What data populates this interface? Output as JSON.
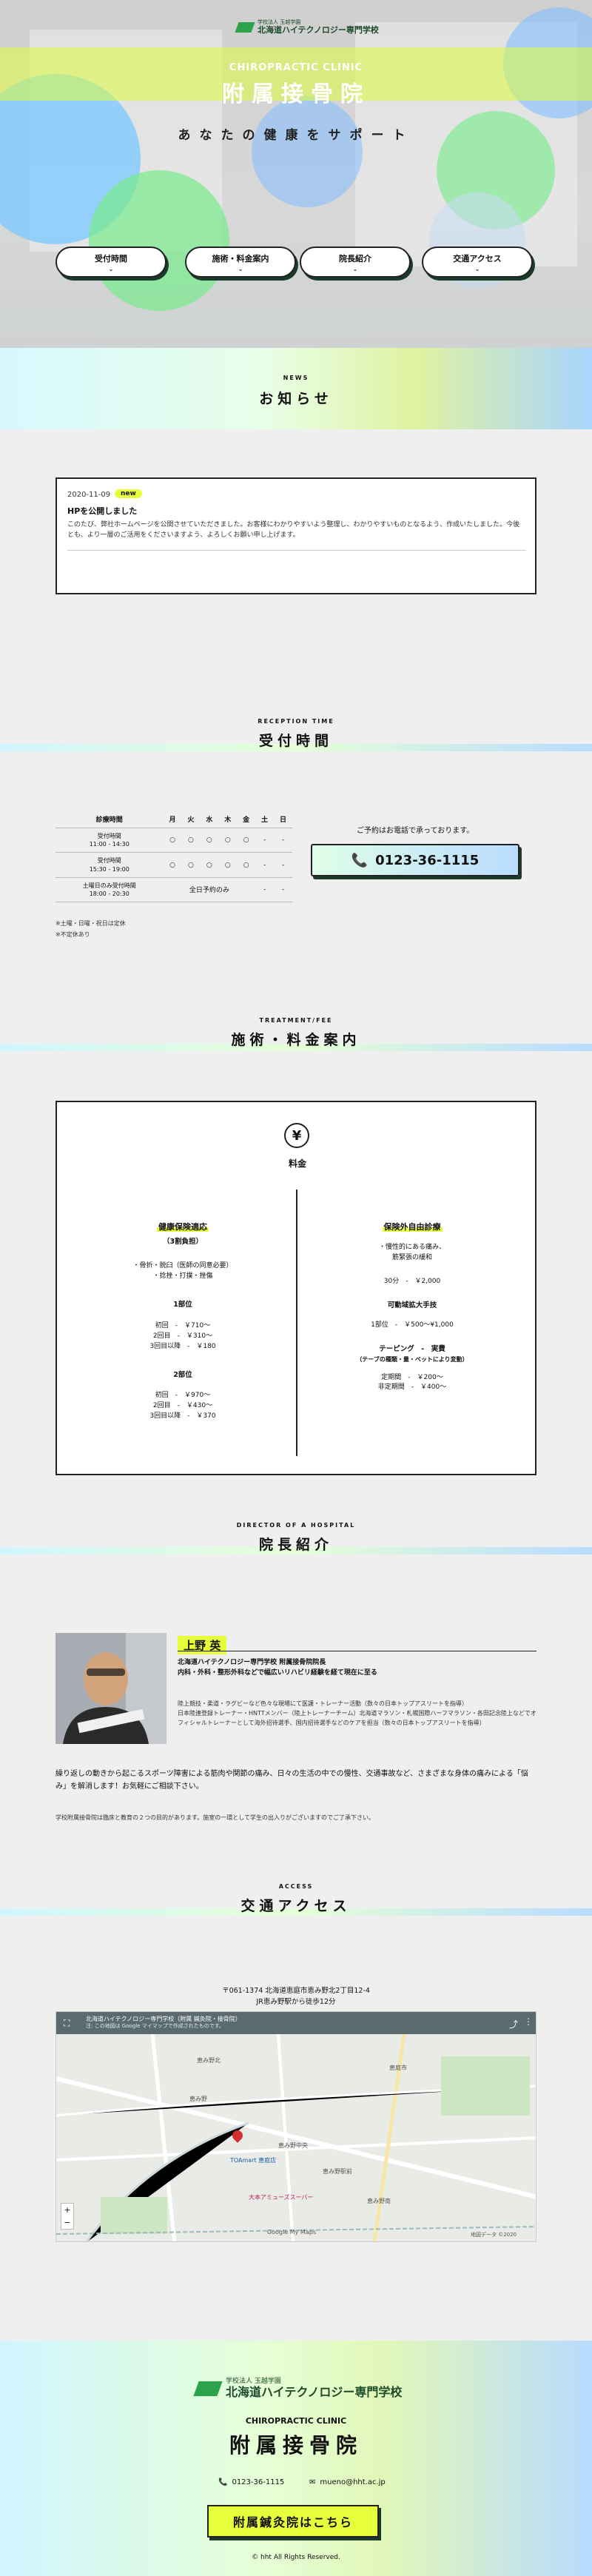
{
  "hero": {
    "logo_small": "学校法人 玉越学園",
    "logo_name": "北海道ハイテクノロジー専門学校",
    "subtitle": "CHIROPRACTIC CLINIC",
    "title": "附属接骨院",
    "lead": "あなたの健康をサポート",
    "buttons": [
      "受付時間",
      "施術・料金案内",
      "院長紹介",
      "交通アクセス"
    ],
    "chevron": "⌄"
  },
  "news": {
    "en": "NEWS",
    "ja": "お知らせ",
    "date": "2020-11-09",
    "badge": "new",
    "title": "HPを公開しました",
    "body": "このたび、弊社ホームページを公開させていただきました。お客様にわかりやすいよう整理し、わかりやすいものとなるよう、作成いたしました。今後とも、より一層のご活用をくださいますよう、よろしくお願い申し上げます。"
  },
  "reception": {
    "en": "RECEPTION TIME",
    "ja": "受付時間",
    "headers": [
      "診療時間",
      "月",
      "火",
      "水",
      "木",
      "金",
      "土",
      "日"
    ],
    "rows": [
      {
        "label": "受付時間",
        "time": "11:00 - 14:30",
        "cells": [
          "○",
          "○",
          "○",
          "○",
          "○",
          "-",
          "-"
        ]
      },
      {
        "label": "受付時間",
        "time": "15:30 - 19:00",
        "cells": [
          "○",
          "○",
          "○",
          "○",
          "○",
          "-",
          "-"
        ]
      },
      {
        "label": "土曜日のみ受付時間",
        "time": "18:00 - 20:30",
        "merged": "全日予約のみ",
        "cells": [
          "-",
          "-"
        ]
      }
    ],
    "tel_note": "ご予約はお電話で承っております。",
    "tel": "0123-36-1115",
    "note1": "※土曜・日曜・祝日は定休",
    "note2": "※不定休あり"
  },
  "treatment": {
    "en": "TREATMENT/FEE",
    "ja": "施術・料金案内",
    "icon": "¥",
    "label": "料金",
    "left": {
      "heading": "健康保険適応",
      "sub": "（3割負担）",
      "desc": "・骨折・脱臼（医師の同意必要）\n・捻挫・打撲・挫傷",
      "part1_title": "1部位",
      "part1_fees": "初回　-　￥710〜\n2回目　-　￥310〜\n3回目以降　-　￥180",
      "part2_title": "2部位",
      "part2_fees": "初回　-　￥970〜\n2回目　-　￥430〜\n3回目以降　-　￥370"
    },
    "right": {
      "heading": "保険外自由診療",
      "desc": "・慢性的にある痛み、\n筋緊張の緩和",
      "fee1": "30分　-　￥2,000",
      "sub_title": "可動域拡大手技",
      "fee2": "1部位　-　￥500〜¥1,000",
      "taping_title": "テーピング　-　実費",
      "taping_sub": "（テーブの種類・量・ベットにより変動）",
      "taping_fees": "定期間　-　￥200〜\n非定期間　-　￥400〜"
    }
  },
  "director": {
    "en": "DIRECTOR OF A HOSPITAL",
    "ja": "院長紹介",
    "name": "上野 英",
    "title": "北海道ハイテクノロジー専門学校 附属接骨院院長\n内科・外科・整形外科などで幅広いリハビリ経験を経て現在に至る",
    "career": "陸上競技・柔道・ラグビーなど色々な現場にて医護・トレーナー活動（数々の日本トップアスリートを指導）\n日本陸連登録トレーナー・HNTTメンバー（陸上トレーナーチーム）北海道マラソン・札幌国際ハーフマラソン・各田記念陸上などでオフィシャルトレーナーとして海外招待選手、国内招待選手などのケアを担当（数々の日本トップアスリートを指導）",
    "message": "繰り返しの動きから起こるスポーツ障害による筋肉や関節の痛み、日々の生活の中での慢性、交通事故など、さまざまな身体の痛みによる「悩み」を解消します！お気軽にご相談下さい。",
    "note": "学校附属接骨院は臨床と教育の２つの目的があります。施室の一環として学生の出入りがございますのでご了承下さい。"
  },
  "access": {
    "en": "ACCESS",
    "ja": "交通アクセス",
    "address": "〒061-1374 北海道恵庭市恵み野北2丁目12-4",
    "station": "JR恵み野駅から徒歩12分",
    "map_title": "北海道ハイテクノロジー専門学校（附属 鍼灸院・接骨院）",
    "map_sub": "注: この地図は Google マイマップで作成されたものです。",
    "map_labels": [
      "恵み野",
      "恵み野北",
      "恵庭市",
      "恵み野中央",
      "TOAmart 恵庭店",
      "恵み野駅前",
      "恵み野南",
      "大本アミューズスーパー",
      "Google My Maps",
      "地図データ ©2020"
    ]
  },
  "footer": {
    "logo_small": "学校法人 玉越学園",
    "logo_name": "北海道ハイテクノロジー専門学校",
    "sub": "CHIROPRACTIC CLINIC",
    "title": "附属接骨院",
    "tel": "0123-36-1115",
    "mail": "mueno@hht.ac.jp",
    "cta": "附属鍼灸院はこちら",
    "copy": "© hht All Rights Reserved."
  },
  "colors": {
    "accent": "#e7ff3a",
    "dark": "#1c3a2a",
    "brand_green": "#2aa34a"
  }
}
